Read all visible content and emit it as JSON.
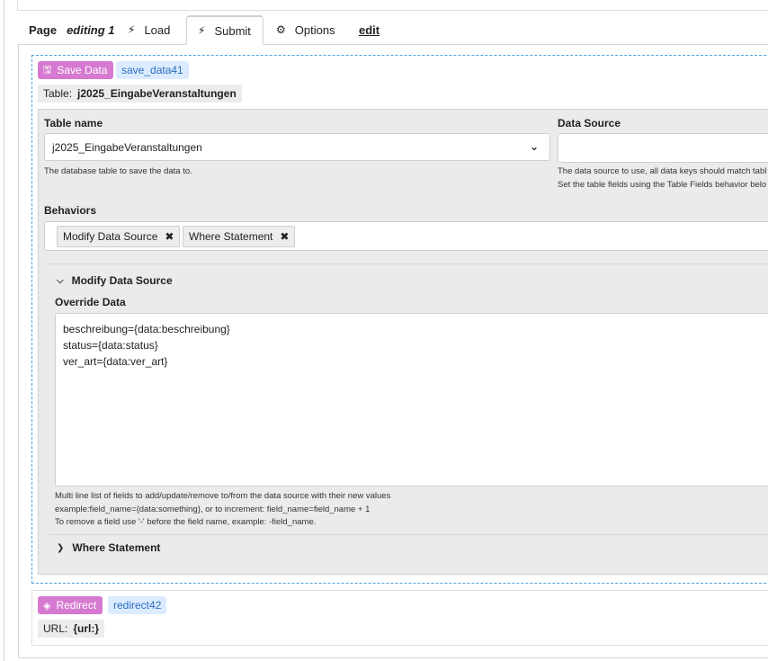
{
  "tabs": {
    "page_label": "Page",
    "page_mode": "editing 1",
    "load": "Load",
    "submit": "Submit",
    "options": "Options",
    "edit": "edit",
    "active": "Submit"
  },
  "save_block": {
    "badge_label": "Save Data",
    "id": "save_data41",
    "table_prefix": "Table:",
    "table_value": "j2025_EingabeVeranstaltungen",
    "table_name_label": "Table name",
    "table_name_value": "j2025_EingabeVeranstaltungen",
    "table_name_help": "The database table to save the data to.",
    "data_source_label": "Data Source",
    "data_source_value": "",
    "data_source_help_1": "The data source to use, all data keys should match tabl",
    "data_source_help_2": "Set the table fields using the Table Fields behavior belo",
    "behaviors_label": "Behaviors",
    "behaviors": [
      "Modify Data Source",
      "Where Statement"
    ],
    "modify_section": {
      "title": "Modify Data Source",
      "expanded": true,
      "override_label": "Override Data",
      "override_lines": [
        "beschreibung={data:beschreibung}",
        "status={data:status}",
        "ver_art={data:ver_art}"
      ],
      "help_1": "Multi line list of fields to add/update/remove to/from the data source with their new values",
      "help_2": "example:field_name={data:something}, or to increment: field_name=field_name + 1",
      "help_3": "To remove a field use '-' before the field name, example: -field_name."
    },
    "where_section": {
      "title": "Where Statement",
      "expanded": false
    }
  },
  "redirect_block": {
    "badge_label": "Redirect",
    "id": "redirect42",
    "url_prefix": "URL:",
    "url_value": "{url:}"
  },
  "colors": {
    "badge_purple": "#d67ad1",
    "id_badge_bg": "#dcebff",
    "id_badge_text": "#2c6fbf",
    "dashed_border": "#4aa3df"
  }
}
